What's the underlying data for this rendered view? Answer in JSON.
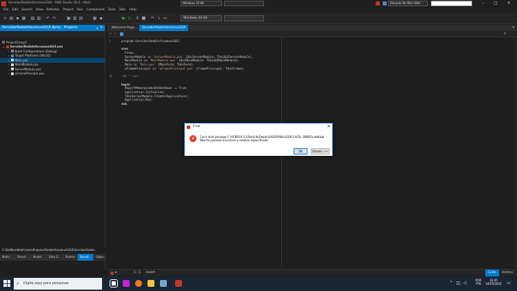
{
  "window": {
    "title": "ServidorRedeInfocomuniGUI - RAD Studio 10.3 - Main",
    "layout_value": "Windows 32-bit",
    "user": "Eduardo Do Mesi Web",
    "controls": {
      "minimize": "–",
      "maximize": "□",
      "close": "✕"
    }
  },
  "menu": [
    "File",
    "Edit",
    "Search",
    "View",
    "Refactor",
    "Project",
    "Run",
    "Component",
    "Tools",
    "Tabs",
    "Help"
  ],
  "toolbar": {
    "platform": "Windows 32-bit"
  },
  "projects": {
    "header": "ServidorRedeInfocomuniGUI.dproj - Projects",
    "items": [
      {
        "label": "ProjectGroup1",
        "level": 0
      },
      {
        "label": "ServidorRedeInfocomuniGUI.exe",
        "level": 1,
        "bold": true
      },
      {
        "label": "Build Configurations (Debug)",
        "level": 2
      },
      {
        "label": "Target Platforms (Win32)",
        "level": 2
      },
      {
        "label": "Main.pas",
        "level": 2,
        "selected": true
      },
      {
        "label": "MainModule.pas",
        "level": 2
      },
      {
        "label": "ServerModule.pas",
        "level": 2
      },
      {
        "label": "uFramePrincipal.pas",
        "level": 2
      }
    ],
    "path": "C:\\EleMoreWebFontes\\Projetos\\RedeInfocomuni\\GUI\\ServidorRedeIn",
    "bottom_tabs": [
      "Multi-...",
      "Struct...",
      "Model...",
      "Data E...",
      "Palette",
      "Servid...",
      "Objec..."
    ]
  },
  "editor": {
    "tabs": [
      "Welcome Page",
      "ServidorRedeInfocomuniGUI"
    ],
    "code": [
      {
        "t": "program ServidorRedeInfocomuniGUI;",
        "g": "1"
      },
      {
        "t": "",
        "g": ""
      },
      {
        "t": "uses",
        "g": "",
        "kw": true
      },
      {
        "t": "  Forms,",
        "g": ""
      },
      {
        "t": "  ServerModule in 'ServerModule.pas' {UniServerModule: TUniGUIServerModule},",
        "g": "·"
      },
      {
        "t": "  MainModule in 'MainModule.pas' {UniMainModule: TUniGUIMainModule},",
        "g": ""
      },
      {
        "t": "  Main in 'Main.pas' {MainForm: TUniForm},",
        "g": ""
      },
      {
        "t": "  uFramePrincipal in 'uFramePrincipal.pas' {FramePrincipal: TUniFrame};",
        "g": "·"
      },
      {
        "t": "",
        "g": ""
      },
      {
        "t": "{$R *.res}",
        "g": "10",
        "cmt": true
      },
      {
        "t": "",
        "g": ""
      },
      {
        "t": "begin",
        "g": "",
        "kw": true
      },
      {
        "t": "  ReportMemoryLeaksOnShutdown := True;",
        "g": ""
      },
      {
        "t": "  Application.Initialize;",
        "g": ""
      },
      {
        "t": "  TUniServerModule.Create(Application);",
        "g": "·"
      },
      {
        "t": "  Application.Run;",
        "g": ""
      },
      {
        "t": "end.",
        "g": "",
        "kw": true
      }
    ]
  },
  "status": {
    "position": "1 : 1",
    "mode": "Insert",
    "code_tab": "Code",
    "history_tab": "History"
  },
  "dialog": {
    "title": "Error",
    "line1": "Can't load package C:\\ACBR10.3.1\\Bar\\Lib\\Delphi\\LibD26\\Win32\\DCLACBr_SNREGuiaW.bpl.",
    "line2": "Não foi possível encontrar o módulo especificado.",
    "ok": "OK",
    "details": "Details >>",
    "close": "✕"
  },
  "taskbar": {
    "search_placeholder": "Digite aqui para pesquisar",
    "lang": "POR",
    "lang2": "PTB",
    "time": "16:45",
    "date": "24/05/2020"
  },
  "colors": {
    "accent": "#007acc",
    "error": "#d8362d"
  }
}
